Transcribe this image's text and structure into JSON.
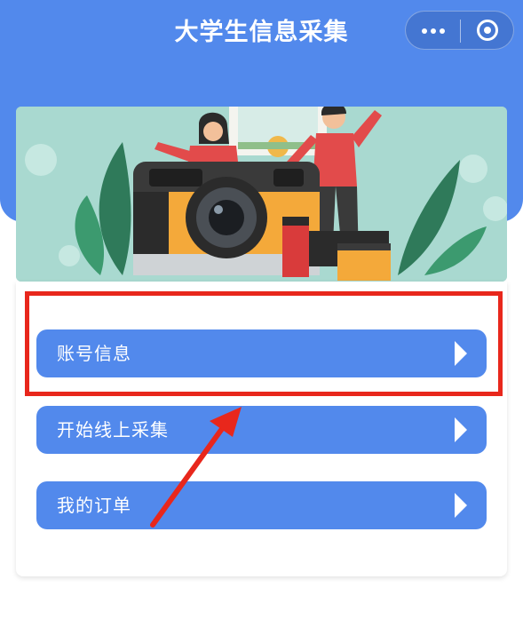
{
  "app": {
    "title": "大学生信息采集"
  },
  "capsule": {
    "more_icon": "more-dots-icon",
    "close_icon": "close-miniprogram-icon"
  },
  "banner": {
    "icon": "camera-illustration"
  },
  "menu": {
    "items": [
      {
        "label": "账号信息",
        "icon": "chevron-right-icon"
      },
      {
        "label": "开始线上采集",
        "icon": "chevron-right-icon"
      },
      {
        "label": "我的订单",
        "icon": "chevron-right-icon"
      }
    ]
  },
  "colors": {
    "primary": "#5289ec",
    "annotation": "#e8271c",
    "banner_bg": "#a9d9d0"
  }
}
